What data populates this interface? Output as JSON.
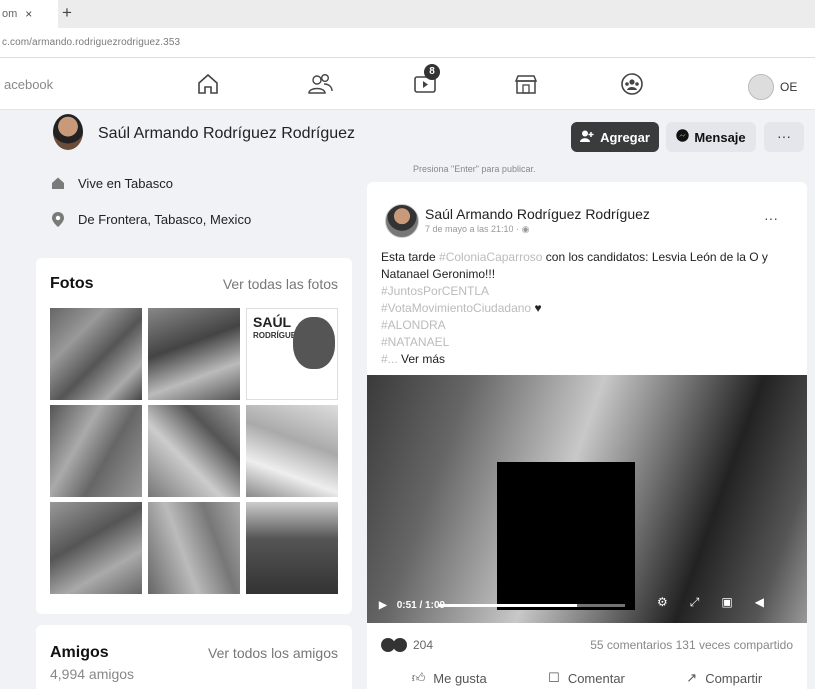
{
  "browser": {
    "tab_label": "om",
    "tab_close": "×",
    "new_tab": "+",
    "url": "c.com/armando.rodriguezrodriguez.353"
  },
  "fbnav": {
    "brand": "acebook",
    "notification_badge": "8",
    "me_label": "OE",
    "icons": [
      "home-icon",
      "friends-icon",
      "watch-icon",
      "marketplace-icon",
      "groups-icon"
    ]
  },
  "profile": {
    "name": "Saúl Armando Rodríguez Rodríguez",
    "add_label": "Agregar",
    "message_label": "Mensaje",
    "more_label": "···",
    "lives_prefix": "Vive en ",
    "lives_place": "Tabasco",
    "from_prefix": "De ",
    "from_place": "Frontera, Tabasco, Mexico"
  },
  "photos": {
    "title": "Fotos",
    "see_all": "Ver todas las fotos",
    "poster_title": "SAÚL",
    "poster_sub": "RODRÍGUEZ"
  },
  "friends": {
    "title": "Amigos",
    "see_all": "Ver todos los amigos",
    "count": "4,994 amigos"
  },
  "composer": {
    "hint": "Presiona \"Enter\" para publicar."
  },
  "post": {
    "author": "Saúl Armando Rodríguez Rodríguez",
    "meta": "7 de mayo a las 21:10 · ",
    "more": "···",
    "text_intro": "Esta tarde ",
    "hashtag_1": "#ColoniaCaparroso",
    "text_rest": " con los candidatos: Lesvia León de la O y Natanael Geronimo!!!",
    "hashtag_2": "#JuntosPorCENTLA",
    "hashtag_3": "#VotaMovimientoCiudadano",
    "hashtag_4": "#ALONDRA",
    "hashtag_5": "#NATANAEL",
    "hashtag_6": "#...",
    "see_more": " Ver más",
    "video_time": "0:51 / 1:09",
    "video_progress": 0.74,
    "reaction_count": "204",
    "engagement": "55 comentarios  131 veces compartido",
    "like_label": "Me gusta",
    "comment_label": "Comentar",
    "share_label": "Compartir"
  }
}
